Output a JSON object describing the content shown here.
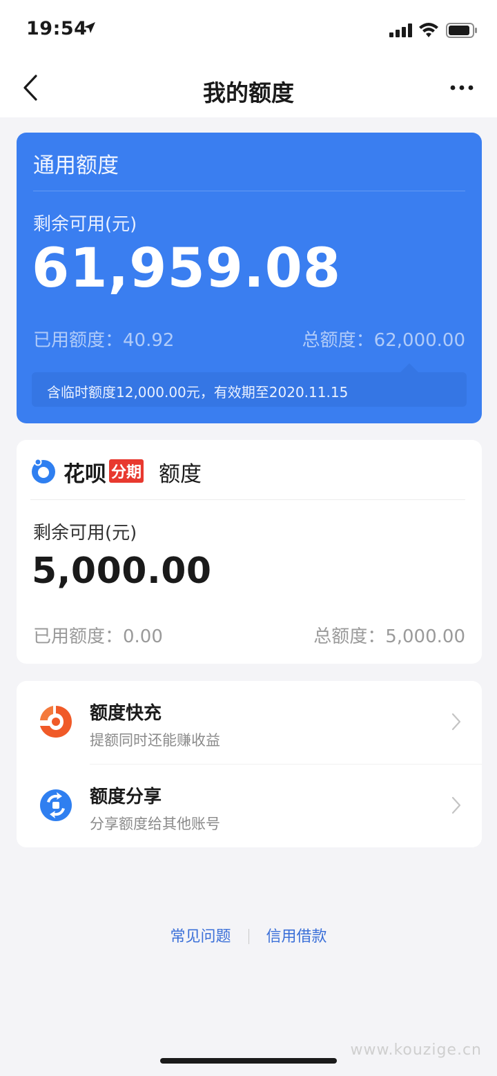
{
  "status_bar": {
    "time": "19:54"
  },
  "header": {
    "title": "我的额度"
  },
  "general_credit": {
    "title": "通用额度",
    "available_label": "剩余可用(元)",
    "available_amount": "61,959.08",
    "used": "已用额度：40.92",
    "total": "总额度：62,000.00",
    "note": "含临时额度12,000.00元，有效期至2020.11.15"
  },
  "huabei_installment": {
    "brand": "花呗",
    "tag": "分期",
    "suffix": "额度",
    "available_label": "剩余可用(元)",
    "available_amount": "5,000.00",
    "used": "已用额度：0.00",
    "total": "总额度：5,000.00"
  },
  "services": [
    {
      "title": "额度快充",
      "subtitle": "提额同时还能赚收益",
      "icon": "quick-charge-icon",
      "icon_color": "#f05a28"
    },
    {
      "title": "额度分享",
      "subtitle": "分享额度给其他账号",
      "icon": "share-credit-icon",
      "icon_color": "#2f7ff0"
    }
  ],
  "footer": {
    "faq": "常见问题",
    "credit_loan": "信用借款"
  },
  "watermark": "www.kouzige.cn",
  "colors": {
    "primary_blue": "#3a7ef0",
    "tag_red": "#e8392f",
    "link_blue": "#3a6fd8"
  }
}
